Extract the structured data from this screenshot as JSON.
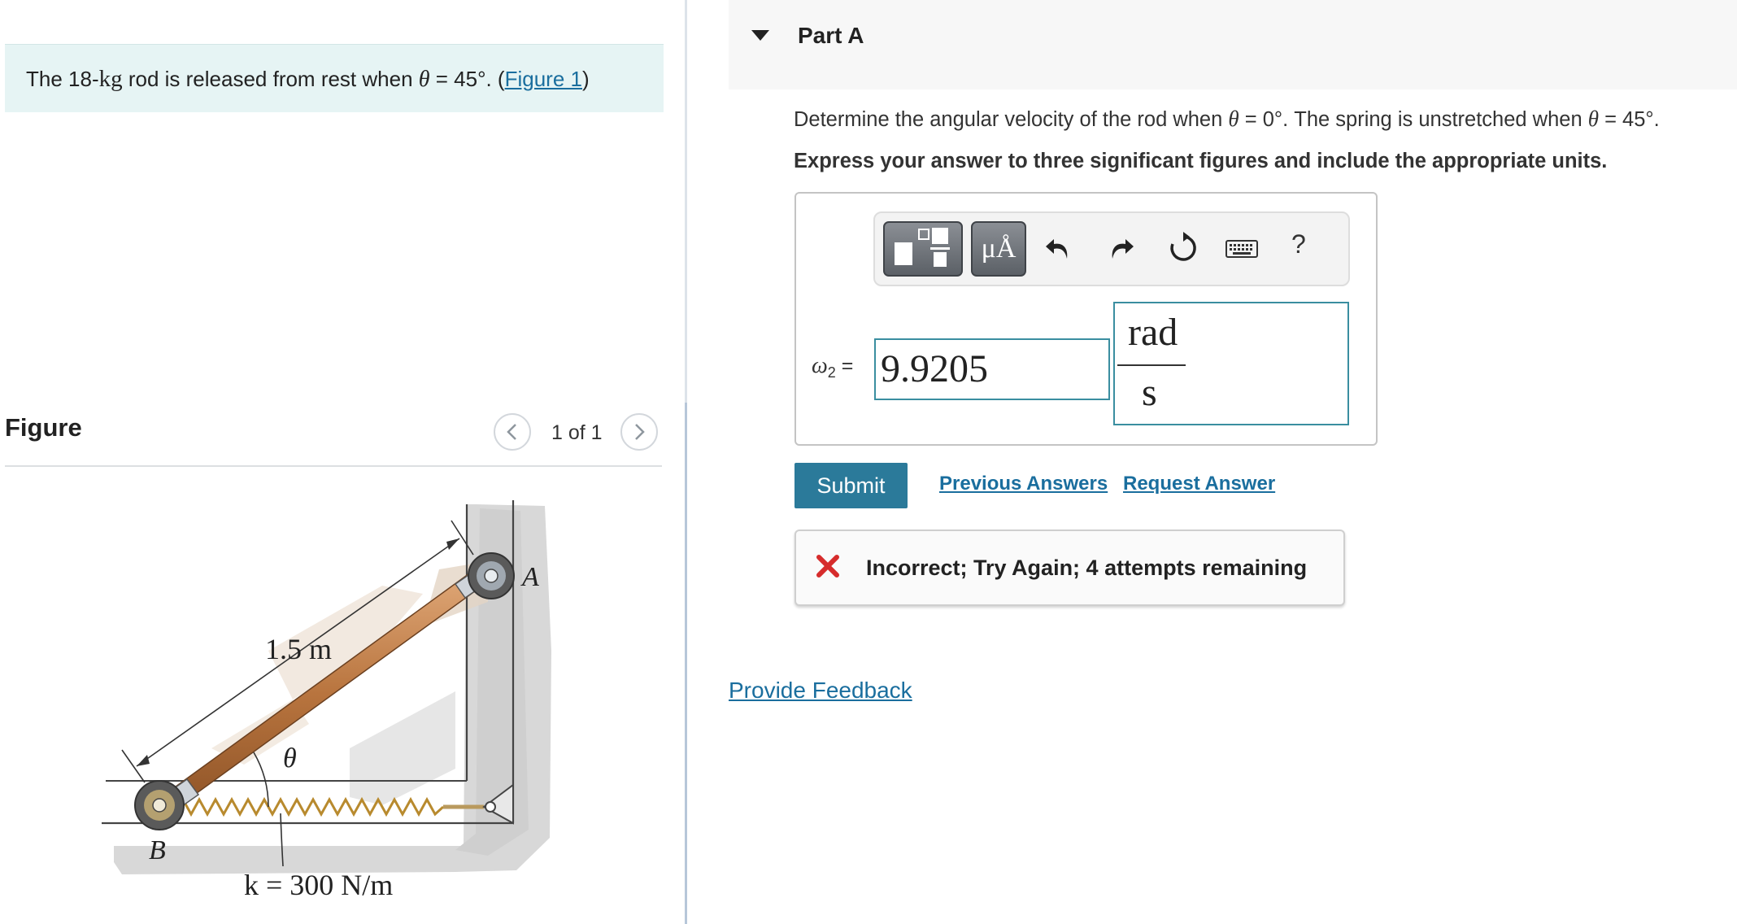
{
  "problem": {
    "text_before": "The 18-",
    "mass_unit": "kg",
    "text_middle": " rod is released from rest when ",
    "theta_symbol": "θ",
    "text_after": " = 45°. (",
    "figure_link": "Figure 1",
    "close_paren": ")"
  },
  "figure_panel": {
    "title": "Figure",
    "pager_text": "1 of 1",
    "prev_icon": "chevron-left-icon",
    "next_icon": "chevron-right-icon",
    "labels": {
      "length": "1.5 m",
      "angle": "θ",
      "point_a": "A",
      "point_b": "B",
      "spring": "k = 300 N/m"
    }
  },
  "part": {
    "title": "Part A",
    "question_before": "Determine the angular velocity of the rod when ",
    "theta_symbol": "θ",
    "question_middle": " = 0°. The spring is unstretched when ",
    "question_after": " = 45°.",
    "instruction": "Express your answer to three significant figures and include the appropriate units."
  },
  "toolbar": {
    "units_label": "μÅ",
    "help_label": "?",
    "icons": [
      "templates-icon",
      "units-icon",
      "undo-icon",
      "redo-icon",
      "reset-icon",
      "keyboard-icon",
      "help-icon"
    ]
  },
  "answer": {
    "variable": "ω",
    "subscript": "2",
    "equals": " =",
    "value": "9.9205",
    "unit_numerator": "rad",
    "unit_denominator": "s"
  },
  "actions": {
    "submit": "Submit",
    "previous_answers": "Previous Answers",
    "request_answer": "Request Answer"
  },
  "feedback": {
    "icon": "x-icon",
    "message": "Incorrect; Try Again; 4 attempts remaining",
    "color": "#d62c2c"
  },
  "provide_feedback": "Provide Feedback",
  "colors": {
    "accent": "#2b7a9a",
    "link": "#1a6e9e",
    "problem_bg": "#e6f4f4",
    "input_border": "#3a8ea0",
    "rod": "#c88a58"
  }
}
